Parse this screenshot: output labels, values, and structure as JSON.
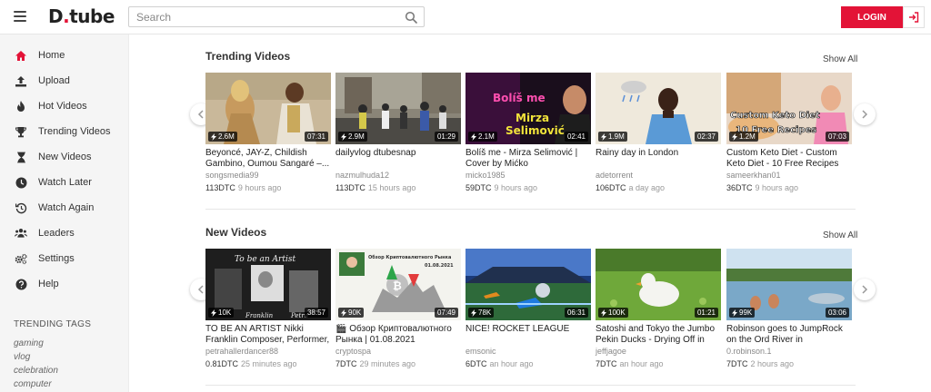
{
  "header": {
    "logo_text": "D",
    "logo_dot": ".",
    "logo_rest": "tube",
    "search_placeholder": "Search",
    "login_label": "LOGIN",
    "accent": "#e31337"
  },
  "sidebar": {
    "items": [
      {
        "label": "Home",
        "icon": "home-icon"
      },
      {
        "label": "Upload",
        "icon": "upload-icon"
      },
      {
        "label": "Hot Videos",
        "icon": "fire-icon"
      },
      {
        "label": "Trending Videos",
        "icon": "trophy-icon"
      },
      {
        "label": "New Videos",
        "icon": "hourglass-icon"
      },
      {
        "label": "Watch Later",
        "icon": "clock-icon"
      },
      {
        "label": "Watch Again",
        "icon": "history-icon"
      },
      {
        "label": "Leaders",
        "icon": "users-icon"
      },
      {
        "label": "Settings",
        "icon": "cogs-icon"
      },
      {
        "label": "Help",
        "icon": "question-icon"
      }
    ],
    "tags_title": "TRENDING TAGS",
    "tags": [
      "gaming",
      "vlog",
      "celebration",
      "computer"
    ]
  },
  "trending": {
    "title": "Trending Videos",
    "show_all": "Show All",
    "videos": [
      {
        "title": "Beyoncé, JAY-Z, Childish Gambino, Oumou Sangaré –...",
        "author": "songsmedia99",
        "views": "2.6M",
        "duration": "07:31",
        "payout": "113DTC",
        "age": "9 hours ago"
      },
      {
        "title": "dailyvlog dtubesnap",
        "author": "nazmulhuda12",
        "views": "2.9M",
        "duration": "01:29",
        "payout": "113DTC",
        "age": "15 hours ago"
      },
      {
        "title": "Bolíš me - Mirza Selimović | Cover by Mićko",
        "author": "micko1985",
        "views": "2.1M",
        "duration": "02:41",
        "payout": "59DTC",
        "age": "9 hours ago",
        "thumb_text_1": "Bolíš me",
        "thumb_text_2": "Mirza",
        "thumb_text_3": "Selimović"
      },
      {
        "title": "Rainy day in London",
        "author": "adetorrent",
        "views": "1.9M",
        "duration": "02:37",
        "payout": "106DTC",
        "age": "a day ago"
      },
      {
        "title": "Custom Keto Diet - Custom Keto Diet - 10 Free Recipes Custom...",
        "author": "sameerkhan01",
        "views": "1.2M",
        "duration": "07:03",
        "payout": "36DTC",
        "age": "9 hours ago",
        "thumb_text_1": "Custom Keto Diet",
        "thumb_text_2": "10 Free Recipes"
      }
    ]
  },
  "newvideos": {
    "title": "New Videos",
    "show_all": "Show All",
    "videos": [
      {
        "title": "TO BE AN ARTIST Nikki Franklin Composer, Performer, Educator",
        "author": "petrahallerdancer88",
        "views": "10K",
        "duration": "38:57",
        "payout": "0.81DTC",
        "age": "25 minutes ago",
        "thumb_text_1": "To be an Artist",
        "thumb_text_2": "Franklin",
        "thumb_text_3": "Petra"
      },
      {
        "title": "🎬 Обзор Криптовалютного Рынка | 01.08.2021",
        "author": "cryptospa",
        "views": "90K",
        "duration": "07:49",
        "payout": "7DTC",
        "age": "29 minutes ago",
        "thumb_text_1": "Обзор Криптовалютного Рынка",
        "thumb_text_2": "01.08.2021"
      },
      {
        "title": "NICE! ROCKET LEAGUE",
        "author": "emsonic",
        "views": "78K",
        "duration": "06:31",
        "payout": "6DTC",
        "age": "an hour ago"
      },
      {
        "title": "Satoshi and Tokyo the Jumbo Pekin Ducks - Drying Off in the...",
        "author": "jeffjagoe",
        "views": "100K",
        "duration": "01:21",
        "payout": "7DTC",
        "age": "an hour ago"
      },
      {
        "title": "Robinson goes to JumpRock on the Ord River in Kununurra...",
        "author": "0.robinson.1",
        "views": "99K",
        "duration": "03:06",
        "payout": "7DTC",
        "age": "2 hours ago"
      }
    ]
  }
}
